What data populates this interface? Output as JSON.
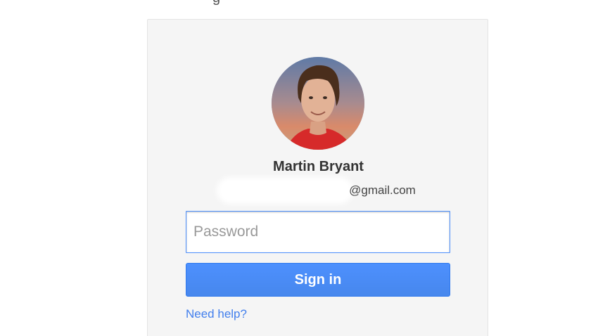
{
  "header": {
    "partial_text": "g"
  },
  "profile": {
    "name": "Martin Bryant",
    "email_domain": "@gmail.com"
  },
  "form": {
    "password_placeholder": "Password",
    "signin_label": "Sign in",
    "help_link": "Need help?"
  },
  "colors": {
    "accent": "#4d90fe",
    "link": "#427fed",
    "card_background": "#f5f5f5"
  }
}
